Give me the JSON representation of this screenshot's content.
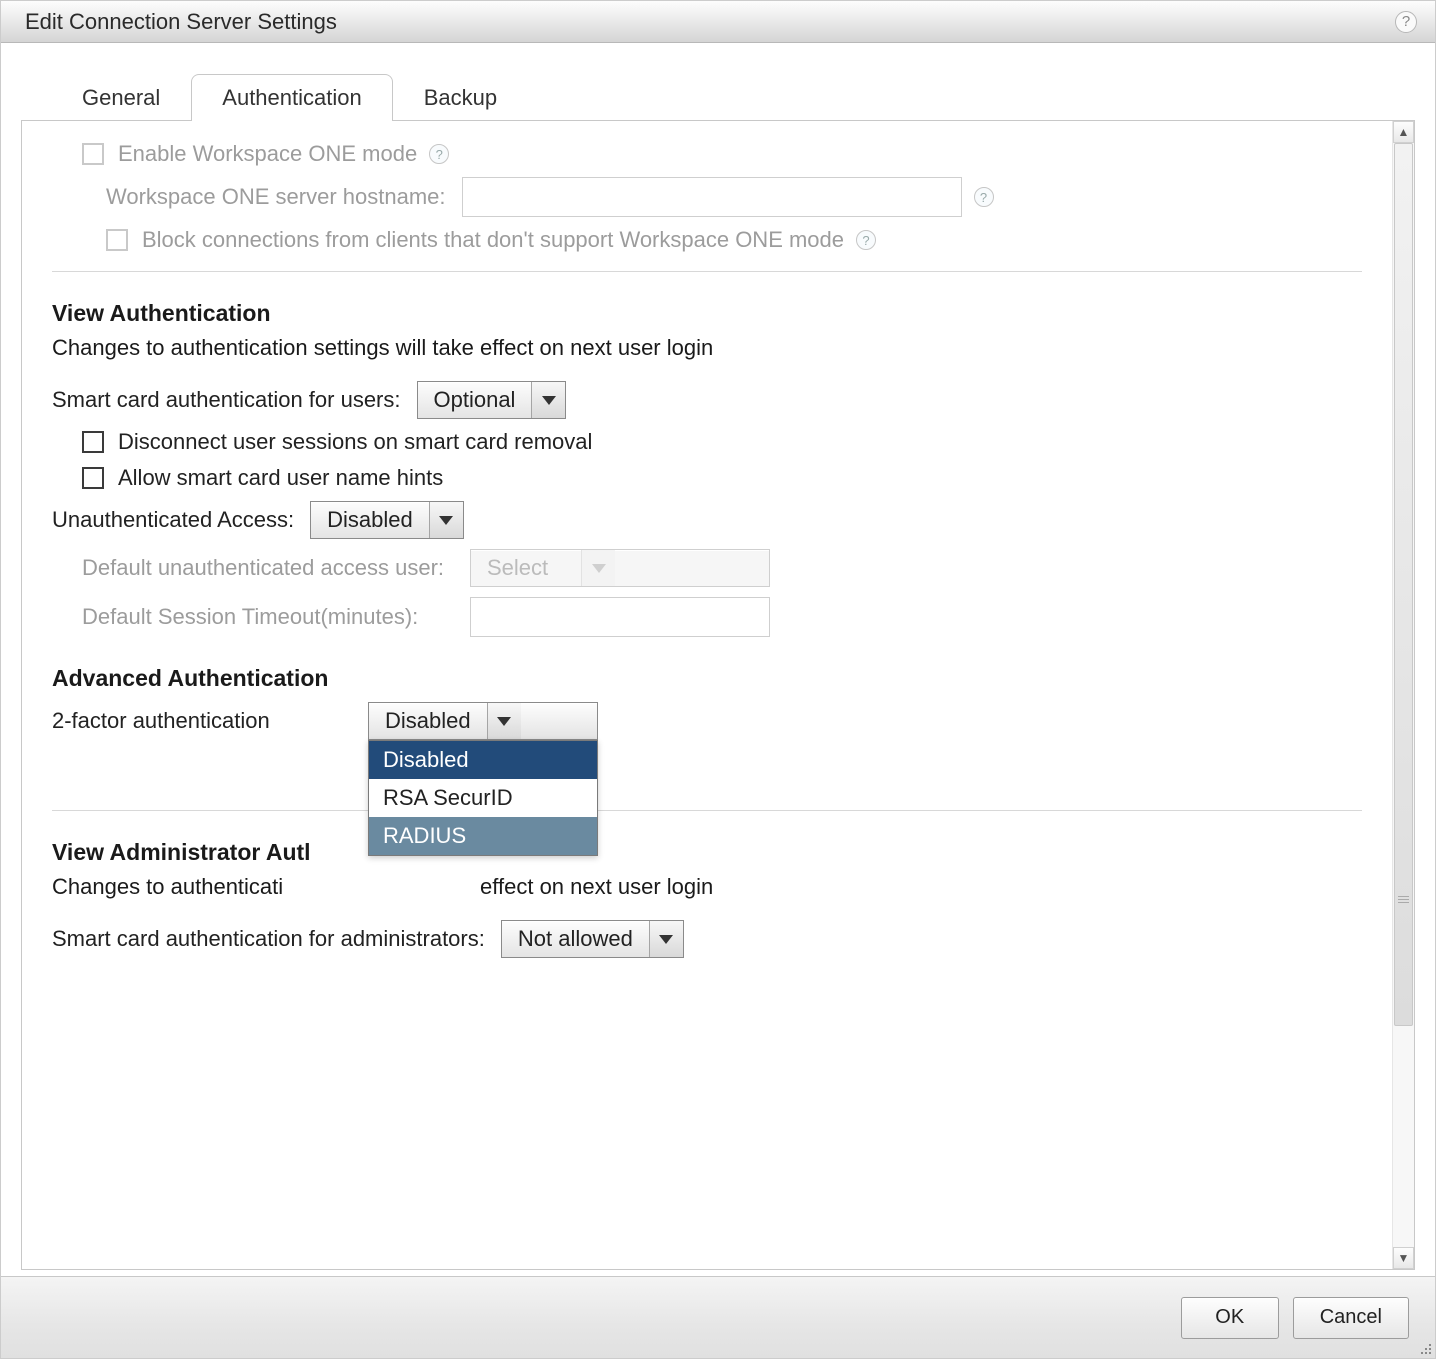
{
  "window": {
    "title": "Edit Connection Server Settings"
  },
  "tabs": {
    "general": "General",
    "authentication": "Authentication",
    "backup": "Backup",
    "active": "authentication"
  },
  "workspace_one": {
    "enable_label": "Enable Workspace ONE mode",
    "hostname_label": "Workspace ONE server hostname:",
    "hostname_value": "",
    "block_label": "Block connections from clients that don't support Workspace ONE mode"
  },
  "view_auth": {
    "title": "View Authentication",
    "subtitle": "Changes to authentication settings will take effect on next user login",
    "smartcard_label": "Smart card authentication for users:",
    "smartcard_value": "Optional",
    "disconnect_label": "Disconnect user sessions on smart card removal",
    "hints_label": "Allow smart card user name hints",
    "unauth_label": "Unauthenticated Access:",
    "unauth_value": "Disabled",
    "default_user_label": "Default unauthenticated access user:",
    "default_user_value": "Select",
    "timeout_label": "Default Session Timeout(minutes):",
    "timeout_value": ""
  },
  "advanced": {
    "title": "Advanced Authentication",
    "twofactor_label": "2-factor authentication",
    "twofactor_value": "Disabled",
    "twofactor_options": {
      "o0": "Disabled",
      "o1": "RSA SecurID",
      "o2": "RADIUS"
    }
  },
  "admin_auth": {
    "title_full": "View Administrator Authentication",
    "title_visible": "View Administrator Autl",
    "subtitle_full": "Changes to authentication settings will take effect on next user login",
    "subtitle_left": "Changes to authenticati",
    "subtitle_right": " effect on next user login",
    "smartcard_label": "Smart card authentication for administrators:",
    "smartcard_value": "Not allowed"
  },
  "footer": {
    "ok": "OK",
    "cancel": "Cancel"
  }
}
